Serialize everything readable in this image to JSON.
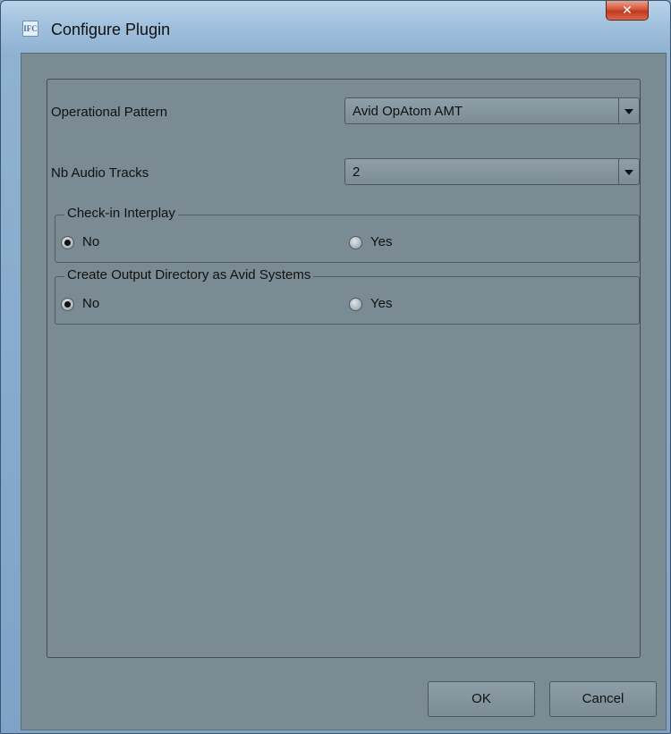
{
  "window": {
    "title": "Configure Plugin",
    "app_icon_text": "IFC",
    "close_glyph": "✕"
  },
  "form": {
    "operational_pattern": {
      "label": "Operational Pattern",
      "value": "Avid OpAtom AMT"
    },
    "audio_tracks": {
      "label": "Nb Audio Tracks",
      "value": "2"
    },
    "checkin_group": {
      "title": "Check-in Interplay",
      "options": [
        {
          "label": "No",
          "checked": true
        },
        {
          "label": "Yes",
          "checked": false
        }
      ]
    },
    "output_dir_group": {
      "title": "Create Output Directory as Avid Systems",
      "options": [
        {
          "label": "No",
          "checked": true
        },
        {
          "label": "Yes",
          "checked": false
        }
      ]
    }
  },
  "buttons": {
    "ok": "OK",
    "cancel": "Cancel"
  }
}
